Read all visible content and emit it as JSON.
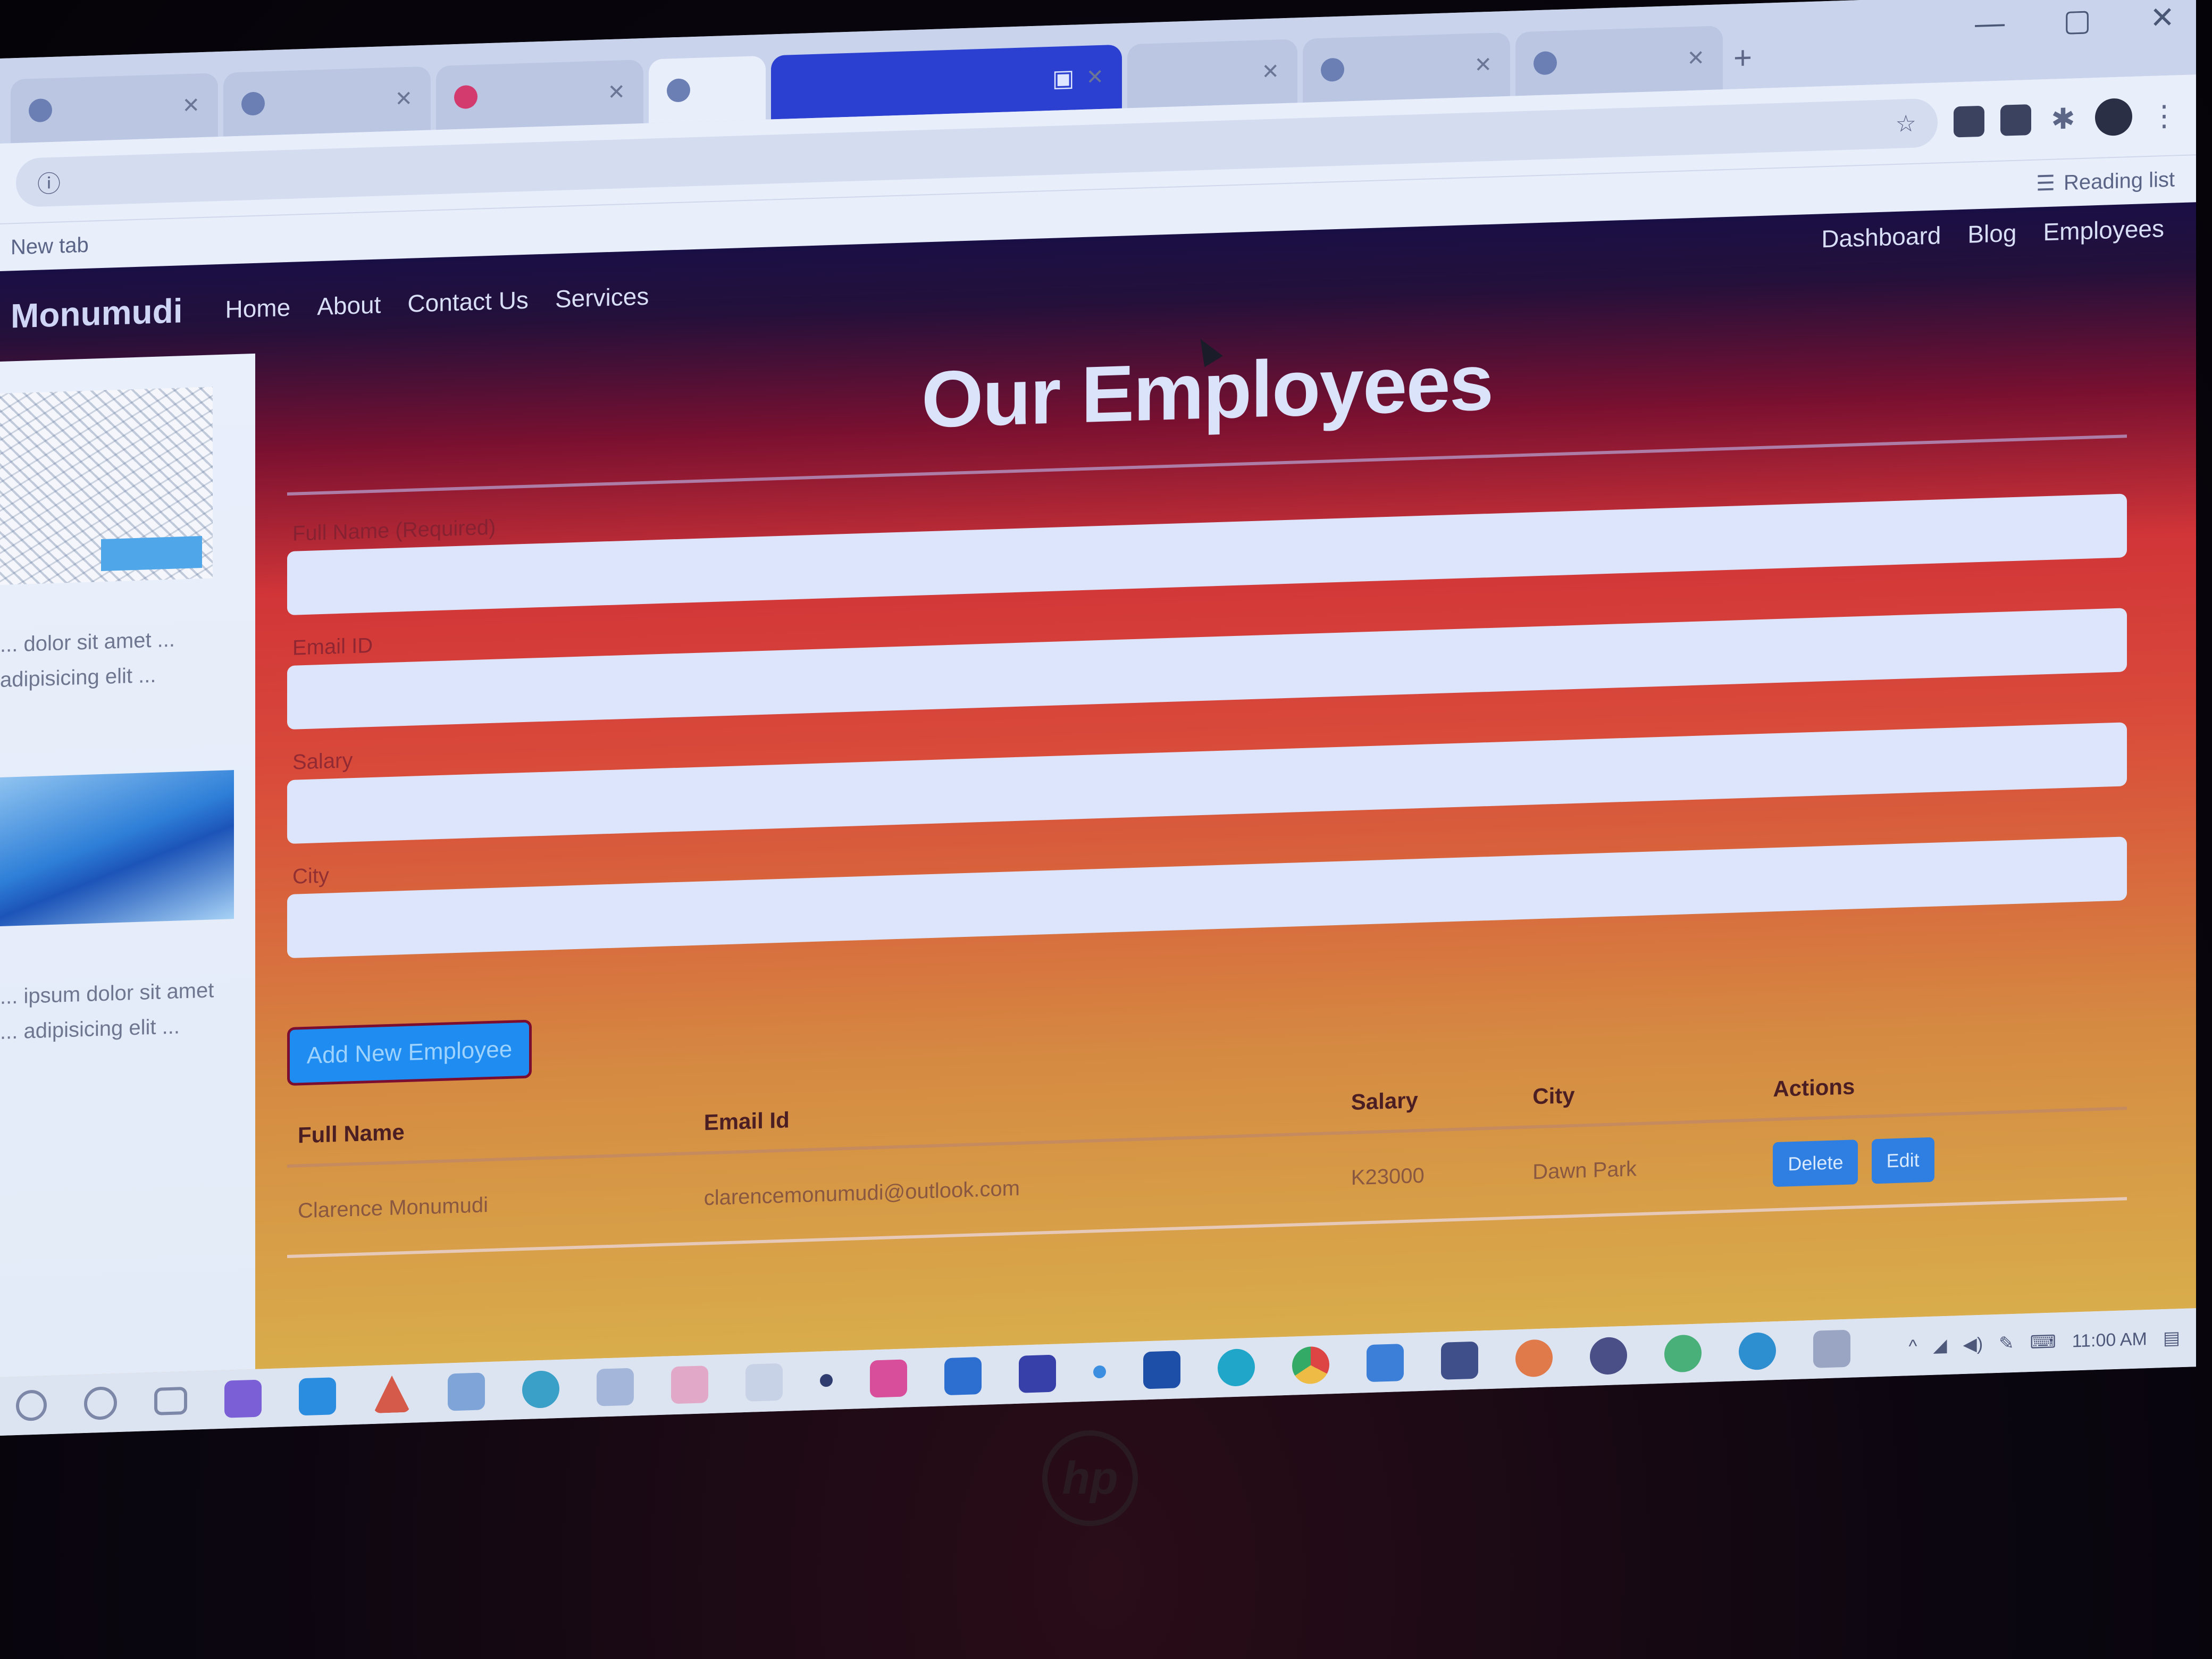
{
  "browser": {
    "tabs": [
      {
        "title": "",
        "icon": "page-icon"
      },
      {
        "title": "",
        "icon": "page-icon"
      },
      {
        "title": "",
        "icon": "page-icon"
      },
      {
        "title": "",
        "icon": "page-icon",
        "active": true
      },
      {
        "title": "",
        "icon": "media-icon",
        "media": true
      },
      {
        "title": "",
        "icon": "page-icon"
      },
      {
        "title": "",
        "icon": "shield-icon"
      },
      {
        "title": "",
        "icon": "shield-icon"
      }
    ],
    "address": "",
    "reading_list": "Reading list",
    "bookmarks_bar": "New tab"
  },
  "site": {
    "brand": "Monumudi",
    "nav_left": [
      "Home",
      "About",
      "Contact Us",
      "Services"
    ],
    "nav_right": [
      "Dashboard",
      "Blog",
      "Employees"
    ]
  },
  "sidebar": {
    "text_1": "... dolor sit amet ... adipisicing elit ...",
    "text_2": "... ipsum dolor sit amet ... adipisicing elit ..."
  },
  "main": {
    "title": "Our Employees",
    "fields": [
      {
        "label": "Full Name (Required)",
        "value": ""
      },
      {
        "label": "Email ID",
        "value": ""
      },
      {
        "label": "Salary",
        "value": ""
      },
      {
        "label": "City",
        "value": ""
      }
    ],
    "add_button": "Add New Employee",
    "table": {
      "headers": [
        "Full Name",
        "Email Id",
        "Salary",
        "City",
        "Actions"
      ],
      "rows": [
        {
          "full_name": "Clarence Monumudi",
          "email": "clarencemonumudi@outlook.com",
          "salary": "K23000",
          "city": "Dawn Park"
        }
      ],
      "delete_label": "Delete",
      "edit_label": "Edit"
    }
  },
  "taskbar": {
    "time": "11:00 AM",
    "date": "",
    "colors": {
      "accent": "#1e8cf0",
      "brand_bar": "#1a0f45"
    }
  }
}
